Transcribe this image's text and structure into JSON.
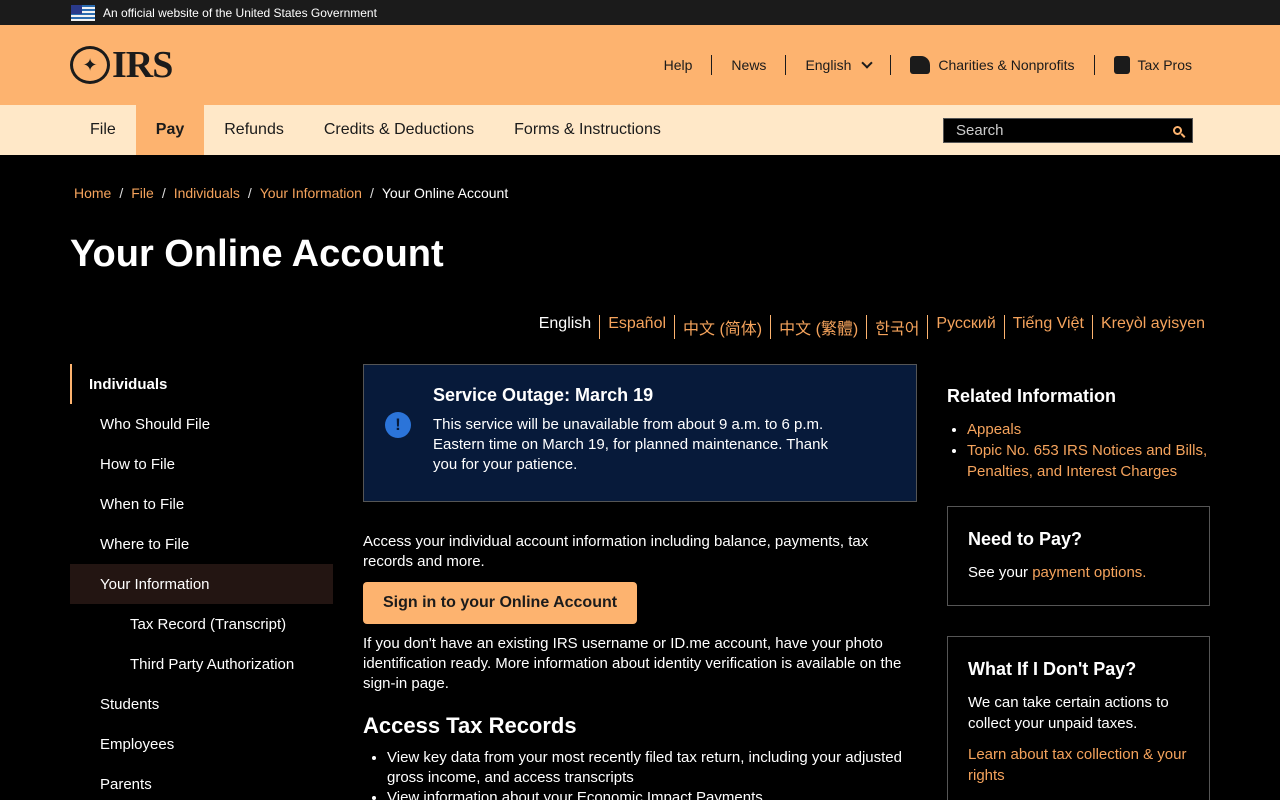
{
  "gov_banner": {
    "text": "An official website of the United States Government"
  },
  "header": {
    "logo_text": "IRS",
    "utility_nav": {
      "help": "Help",
      "news": "News",
      "language": "English",
      "charities": "Charities & Nonprofits",
      "tax_pros": "Tax Pros"
    }
  },
  "main_nav": {
    "items": [
      "File",
      "Pay",
      "Refunds",
      "Credits & Deductions",
      "Forms & Instructions"
    ],
    "active": "Pay",
    "search_placeholder": "Search"
  },
  "breadcrumb": [
    "Home",
    "File",
    "Individuals",
    "Your Information",
    "Your Online Account"
  ],
  "page_title": "Your Online Account",
  "languages": [
    "English",
    "Español",
    "中文 (简体)",
    "中文 (繁體)",
    "한국어",
    "Русский",
    "Tiếng Việt",
    "Kreyòl ayisyen"
  ],
  "sidebar": {
    "heading": "Individuals",
    "items": [
      "Who Should File",
      "How to File",
      "When to File",
      "Where to File",
      "Your Information",
      "Tax Record (Transcript)",
      "Third Party Authorization",
      "Students",
      "Employees",
      "Parents"
    ]
  },
  "alert": {
    "title": "Service Outage: March 19",
    "body": "This service will be unavailable from about 9 a.m. to 6 p.m. Eastern time on March 19, for planned maintenance. Thank you for your patience."
  },
  "main": {
    "intro": "Access your individual account information including balance, payments, tax records and more.",
    "signin_button": "Sign in to your Online Account",
    "note": "If you don't have an existing IRS username or ID.me account, have your photo identification ready. More information about identity verification is available on the sign-in page.",
    "section_title": "Access Tax Records",
    "section_items": [
      "View key data from your most recently filed tax return, including your adjusted gross income, and access transcripts",
      "View information about your Economic Impact Payments"
    ]
  },
  "rail": {
    "related_title": "Related Information",
    "related_links": [
      "Appeals",
      "Topic No. 653 IRS Notices and Bills, Penalties, and Interest Charges"
    ],
    "need_to_pay": {
      "title": "Need to Pay?",
      "text": "See your ",
      "link": "payment options."
    },
    "what_if": {
      "title": "What If I Don't Pay?",
      "text": "We can take certain actions to collect your unpaid taxes.",
      "link": "Learn about tax collection & your rights"
    }
  }
}
